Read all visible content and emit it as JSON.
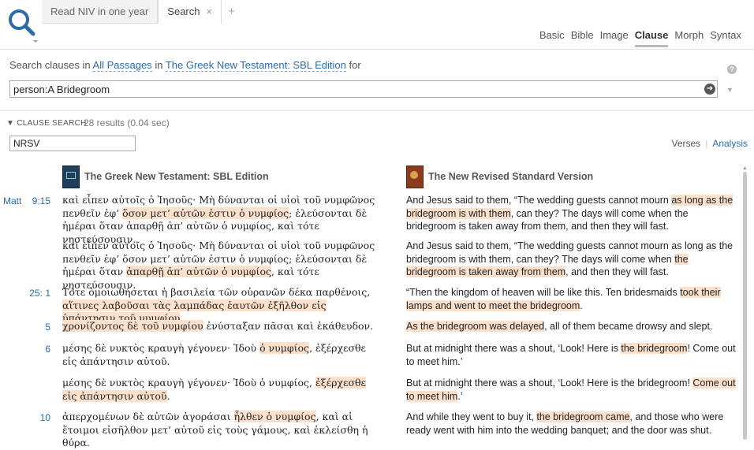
{
  "tabs": [
    {
      "label": "Read NIV in one year"
    },
    {
      "label": "Search",
      "close": "×"
    },
    {
      "label": "+"
    }
  ],
  "modes": [
    "Basic",
    "Bible",
    "Image",
    "Clause",
    "Morph",
    "Syntax"
  ],
  "active_mode": "Clause",
  "search_row": {
    "prefix": "Search clauses in",
    "range": "All Passages",
    "in": "in",
    "source": "The Greek New Testament: SBL Edition",
    "for": "for"
  },
  "query": {
    "value": "person:A Bridegroom"
  },
  "clause_search": {
    "title": "CLAUSE SEARCH",
    "count": "28 results (0.04 sec)"
  },
  "version_input": "NRSV",
  "view_links": {
    "verses": "Verses",
    "analysis": "Analysis"
  },
  "columns": {
    "left": "The Greek New Testament: SBL Edition",
    "right": "The New Revised Standard Version"
  },
  "rows": [
    {
      "book": "Matt",
      "ref": "9:15",
      "gk": [
        [
          "καὶ εἶπεν αὐτοῖς ὁ Ἰησοῦς· Μὴ δύνανται οἱ υἱοὶ τοῦ νυμφῶνος πενθεῖν ἐφ’ ",
          0
        ],
        [
          "ὅσον μετ’ αὐτῶν ἐστιν ὁ νυμφίος",
          1
        ],
        [
          "; ἐλεύσονται δὲ ἡμέραι ὅταν ἀπαρθῇ ἀπ’ αὐτῶν ὁ νυμφίος, καὶ τότε νηστεύσουσιν.",
          0
        ]
      ],
      "en": [
        [
          "And Jesus said to them, “The wedding guests cannot mourn ",
          0
        ],
        [
          "as long as the bridegroom is with them",
          1
        ],
        [
          ", can they? The days will come when the bridegroom is taken away from them, and then they will fast.",
          0
        ]
      ]
    },
    {
      "book": "",
      "ref": "",
      "gk": [
        [
          "καὶ εἶπεν αὐτοῖς ὁ Ἰησοῦς· Μὴ δύνανται οἱ υἱοὶ τοῦ νυμφῶνος πενθεῖν ἐφ’ ὅσον μετ’ αὐτῶν ἐστιν ὁ νυμφίος; ἐλεύσονται δὲ ἡμέραι ὅταν ",
          0
        ],
        [
          "ἀπαρθῇ ἀπ’ αὐτῶν ὁ νυμφίος",
          1
        ],
        [
          ", καὶ τότε νηστεύσουσιν.",
          0
        ]
      ],
      "en": [
        [
          "And Jesus said to them, “The wedding guests cannot mourn as long as the bridegroom is with them, can they? The days will come when ",
          0
        ],
        [
          "the bridegroom is taken away from them",
          1
        ],
        [
          ", and then they will fast.",
          0
        ]
      ]
    },
    {
      "book": "",
      "ref": "25: 1",
      "gk": [
        [
          "Τότε ὁμοιωθήσεται ἡ βασιλεία τῶν οὐρανῶν δέκα παρθένοις, ",
          0
        ],
        [
          "αἵτινες λαβοῦσαι τὰς λαμπάδας ἑαυτῶν ἐξῆλθον εἰς ὑπάντησιν τοῦ νυμφίου",
          1
        ],
        [
          ".",
          0
        ]
      ],
      "en": [
        [
          "“Then the kingdom of heaven will be like this. Ten bridesmaids ",
          0
        ],
        [
          "took their lamps and went to meet the bridegroom",
          1
        ],
        [
          ".",
          0
        ]
      ]
    },
    {
      "book": "",
      "ref": "5",
      "gk": [
        [
          "χρονίζοντος δὲ τοῦ νυμφίου",
          1
        ],
        [
          " ἐνύσταξαν πᾶσαι καὶ ἐκάθευδον.",
          0
        ]
      ],
      "en": [
        [
          "As the bridegroom was delayed",
          1
        ],
        [
          ", all of them became drowsy and slept.",
          0
        ]
      ]
    },
    {
      "book": "",
      "ref": "6",
      "gk": [
        [
          "μέσης δὲ νυκτὸς κραυγὴ γέγονεν· Ἰδοὺ ",
          0
        ],
        [
          "ὁ νυμφίος",
          1
        ],
        [
          ", ἐξέρχεσθε εἰς ἀπάντησιν αὐτοῦ.",
          0
        ]
      ],
      "en": [
        [
          "But at midnight there was a shout, ‘Look! Here is ",
          0
        ],
        [
          "the bridegroom",
          1
        ],
        [
          "! Come out to meet him.’",
          0
        ]
      ]
    },
    {
      "book": "",
      "ref": "",
      "gk": [
        [
          "μέσης δὲ νυκτὸς κραυγὴ γέγονεν· Ἰδοὺ ὁ νυμφίος, ",
          0
        ],
        [
          "ἐξέρχεσθε εἰς ἀπάντησιν αὐτοῦ",
          1
        ],
        [
          ".",
          0
        ]
      ],
      "en": [
        [
          "But at midnight there was a shout, ‘Look! Here is the bridegroom! ",
          0
        ],
        [
          "Come out to meet him",
          1
        ],
        [
          ".’",
          0
        ]
      ]
    },
    {
      "book": "",
      "ref": "10",
      "gk": [
        [
          "ἀπερχομένων δὲ αὐτῶν ἀγοράσαι ",
          0
        ],
        [
          "ἦλθεν ὁ νυμφίος",
          1
        ],
        [
          ", καὶ αἱ ἕτοιμοι εἰσῆλθον μετ’ αὐτοῦ εἰς τοὺς γάμους, καὶ ἐκλείσθη ἡ θύρα.",
          0
        ]
      ],
      "en": [
        [
          "And while they went to buy it, ",
          0
        ],
        [
          "the bridegroom came",
          1
        ],
        [
          ", and those who were ready went with him into the wedding banquet; and the door was shut.",
          0
        ]
      ]
    }
  ]
}
